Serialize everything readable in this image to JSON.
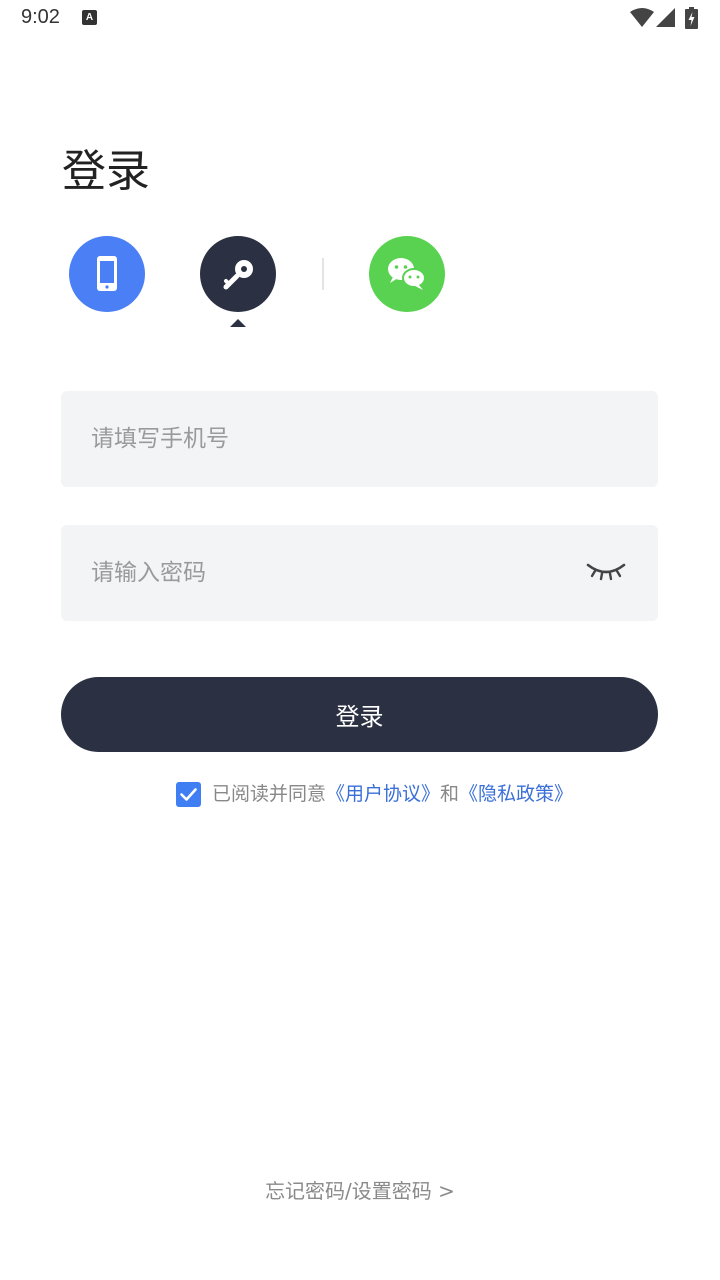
{
  "status_bar": {
    "time": "9:02",
    "notification_icon": "a-letter-icon",
    "notification_letter": "A",
    "icons": [
      "wifi-icon",
      "signal-icon",
      "battery-charging-icon"
    ]
  },
  "page": {
    "title": "登录"
  },
  "login_methods": {
    "items": [
      {
        "icon": "phone-icon",
        "color": "#4a7ff5"
      },
      {
        "icon": "key-icon",
        "color": "#2b3142",
        "selected": true
      },
      {
        "icon": "wechat-icon",
        "color": "#5ad251"
      }
    ]
  },
  "form": {
    "phone_placeholder": "请填写手机号",
    "phone_value": "",
    "password_placeholder": "请输入密码",
    "password_value": "",
    "password_toggle_icon": "eye-closed-icon"
  },
  "login_button": {
    "label": "登录",
    "color": "#2b3142"
  },
  "agreement": {
    "checked": true,
    "prefix": "已阅读并同意",
    "user_agreement": "《用户协议》",
    "conjunction": "和",
    "privacy_policy": "《隐私政策》",
    "link_color": "#3a6fd8"
  },
  "footer": {
    "forgot_password": "忘记密码/设置密码 >"
  }
}
